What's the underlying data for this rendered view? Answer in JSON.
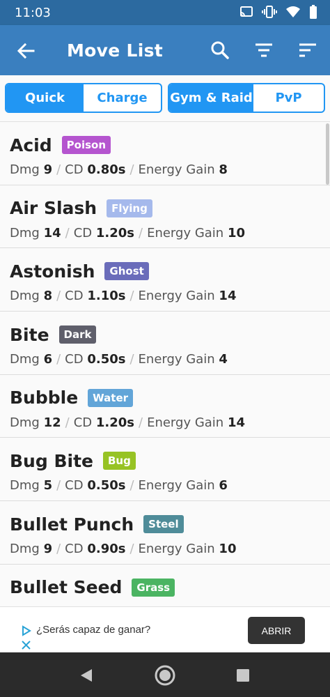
{
  "status_bar": {
    "time": "11:03",
    "icons": [
      "cast-icon",
      "vibrate-icon",
      "wifi-icon",
      "battery-icon"
    ]
  },
  "app_bar": {
    "title": "Move List",
    "icons": [
      "back-arrow-icon",
      "search-icon",
      "filter-icon",
      "sort-icon"
    ]
  },
  "tabs": {
    "move_type": {
      "options": [
        "Quick",
        "Charge"
      ],
      "selected": "Quick"
    },
    "mode": {
      "options": [
        "Gym & Raid",
        "PvP"
      ],
      "selected": "Gym & Raid"
    }
  },
  "labels": {
    "dmg": "Dmg",
    "cd": "CD",
    "energy": "Energy Gain"
  },
  "moves": [
    {
      "name": "Acid",
      "type": "Poison",
      "color": "#b555cf",
      "dmg": "9",
      "cd": "0.80s",
      "energy": "8"
    },
    {
      "name": "Air Slash",
      "type": "Flying",
      "color": "#a5b9ec",
      "dmg": "14",
      "cd": "1.20s",
      "energy": "10"
    },
    {
      "name": "Astonish",
      "type": "Ghost",
      "color": "#6a6cba",
      "dmg": "8",
      "cd": "1.10s",
      "energy": "14"
    },
    {
      "name": "Bite",
      "type": "Dark",
      "color": "#5f5f6b",
      "dmg": "6",
      "cd": "0.50s",
      "energy": "4"
    },
    {
      "name": "Bubble",
      "type": "Water",
      "color": "#62a5d8",
      "dmg": "12",
      "cd": "1.20s",
      "energy": "14"
    },
    {
      "name": "Bug Bite",
      "type": "Bug",
      "color": "#97c324",
      "dmg": "5",
      "cd": "0.50s",
      "energy": "6"
    },
    {
      "name": "Bullet Punch",
      "type": "Steel",
      "color": "#4f8c99",
      "dmg": "9",
      "cd": "0.90s",
      "energy": "10"
    },
    {
      "name": "Bullet Seed",
      "type": "Grass",
      "color": "#4bb462",
      "dmg": "",
      "cd": "",
      "energy": ""
    }
  ],
  "ad": {
    "text": "¿Serás capaz de ganar?",
    "button": "ABRIR"
  },
  "colors": {
    "status_bar": "#2c6aa0",
    "app_bar": "#3a7fbf",
    "accent": "#2196f3",
    "nav_bar": "#2b2b2b"
  }
}
